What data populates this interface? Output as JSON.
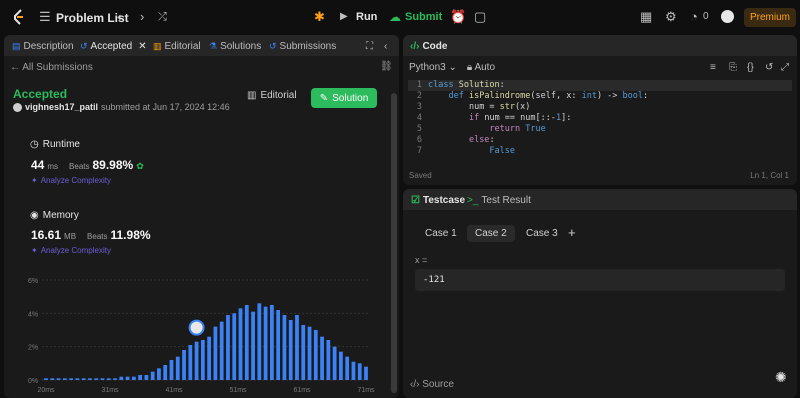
{
  "header": {
    "problem_list": "Problem List",
    "run": "Run",
    "submit": "Submit",
    "streak_count": "0",
    "premium": "Premium"
  },
  "left_tabs": [
    {
      "label": "Description",
      "icon": "document-icon"
    },
    {
      "label": "Accepted",
      "icon": "history-icon"
    },
    {
      "label": "Editorial",
      "icon": "book-icon"
    },
    {
      "label": "Solutions",
      "icon": "flask-icon"
    },
    {
      "label": "Submissions",
      "icon": "history-icon"
    }
  ],
  "submission": {
    "back_label": "All Submissions",
    "status": "Accepted",
    "username": "vighnesh17_patil",
    "submitted_text": "submitted at Jun 17, 2024 12:46",
    "editorial_button": "Editorial",
    "solution_button": "Solution"
  },
  "runtime": {
    "title": "Runtime",
    "value": "44",
    "unit": "ms",
    "beats_label": "Beats",
    "beats_value": "89.98%",
    "analyze": "Analyze Complexity"
  },
  "memory": {
    "title": "Memory",
    "value": "16.61",
    "unit": "MB",
    "beats_label": "Beats",
    "beats_value": "11.98%",
    "analyze": "Analyze Complexity"
  },
  "chart_data": {
    "type": "bar",
    "x_ticks": [
      "20ms",
      "31ms",
      "41ms",
      "51ms",
      "61ms",
      "71ms"
    ],
    "y_ticks": [
      "0%",
      "2%",
      "4%",
      "6%"
    ],
    "ylim": [
      0,
      6
    ],
    "xlim": [
      20,
      71
    ],
    "grid": true,
    "highlight_x": 44,
    "bar_color": "#3b82f6",
    "series": [
      {
        "x": [
          20,
          21,
          22,
          23,
          24,
          25,
          26,
          27,
          28,
          29,
          30,
          31,
          32,
          33,
          34,
          35,
          36,
          37,
          38,
          39,
          40,
          41,
          42,
          43,
          44,
          45,
          46,
          47,
          48,
          49,
          50,
          51,
          52,
          53,
          54,
          55,
          56,
          57,
          58,
          59,
          60,
          61,
          62,
          63,
          64,
          65,
          66,
          67,
          68,
          69,
          70,
          71
        ],
        "values": [
          0.1,
          0.1,
          0.1,
          0.1,
          0.1,
          0.1,
          0.1,
          0.1,
          0.1,
          0.1,
          0.1,
          0.1,
          0.2,
          0.2,
          0.2,
          0.3,
          0.3,
          0.5,
          0.7,
          0.9,
          1.2,
          1.4,
          1.8,
          2.1,
          2.3,
          2.4,
          2.6,
          3.2,
          3.5,
          3.9,
          4.0,
          4.3,
          4.5,
          4.1,
          4.6,
          4.4,
          4.5,
          4.2,
          3.9,
          3.6,
          3.9,
          3.3,
          3.2,
          3.0,
          2.6,
          2.4,
          2.0,
          1.7,
          1.4,
          1.1,
          1.0,
          0.8
        ]
      }
    ]
  },
  "code": {
    "title": "Code",
    "language": "Python3",
    "auto": "Auto",
    "lines": [
      {
        "n": "1",
        "html": "<span class='kw'>class</span> <span class='fn'>Solution</span><span class='pl'>:</span>"
      },
      {
        "n": "2",
        "html": "    <span class='kw'>def</span> <span class='fn'>isPalindrome</span><span class='pl'>(self, x: </span><span class='kw'>int</span><span class='pl'>) -&gt; </span><span class='kw'>bool</span><span class='pl'>:</span>"
      },
      {
        "n": "3",
        "html": "        <span class='pl'>num = </span><span class='fn'>str</span><span class='pl'>(x)</span>"
      },
      {
        "n": "4",
        "html": "        <span class='ret'>if</span> <span class='pl'>num == num[::-</span><span class='kw'>1</span><span class='pl'>]:</span>"
      },
      {
        "n": "5",
        "html": "            <span class='ret'>return</span> <span class='kw'>True</span>"
      },
      {
        "n": "6",
        "html": "        <span class='ret'>else</span><span class='pl'>:</span>"
      },
      {
        "n": "7",
        "html": "            <span class='kw'>False</span>"
      }
    ],
    "saved": "Saved",
    "cursor": "Ln 1, Col 1"
  },
  "testcase": {
    "tab_testcase": "Testcase",
    "tab_result": "Test Result",
    "cases": [
      "Case 1",
      "Case 2",
      "Case 3"
    ],
    "selected_case": 1,
    "var_label": "x =",
    "var_value": "-121",
    "source": "Source"
  }
}
